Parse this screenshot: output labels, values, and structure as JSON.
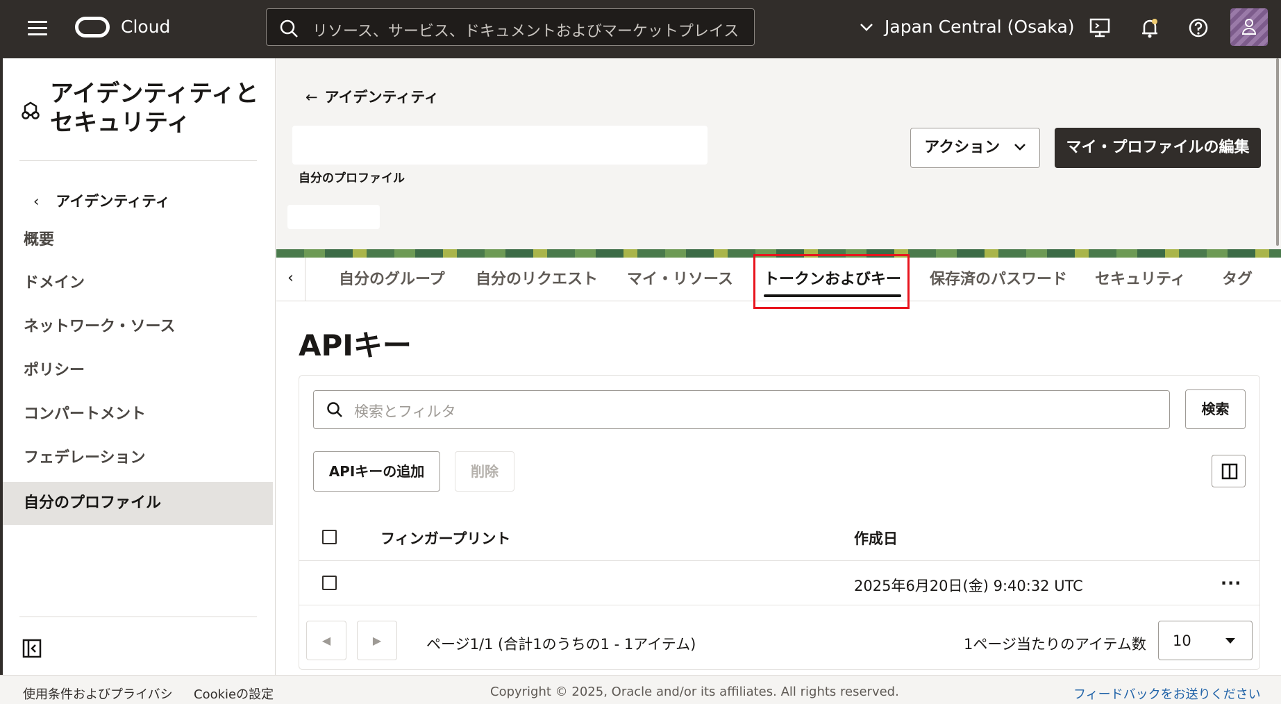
{
  "topbar": {
    "logo_text": "Cloud",
    "search_placeholder": "リソース、サービス、ドキュメントおよびマーケットプレイス",
    "region": "Japan Central (Osaka)"
  },
  "sidebar": {
    "title_line1": "アイデンティティと",
    "title_line2": "セキュリティ",
    "back_label": "アイデンティティ",
    "items": [
      {
        "label": "概要"
      },
      {
        "label": "ドメイン"
      },
      {
        "label": "ネットワーク・ソース"
      },
      {
        "label": "ポリシー"
      },
      {
        "label": "コンパートメント"
      },
      {
        "label": "フェデレーション"
      },
      {
        "label": "自分のプロファイル"
      }
    ]
  },
  "header": {
    "breadcrumb": "アイデンティティ",
    "subtitle": "自分のプロファイル",
    "actions_label": "アクション",
    "edit_label": "マイ・プロファイルの編集"
  },
  "tabs": [
    {
      "label": "自分のグループ"
    },
    {
      "label": "自分のリクエスト"
    },
    {
      "label": "マイ・リソース"
    },
    {
      "label": "トークンおよびキー"
    },
    {
      "label": "保存済のパスワード"
    },
    {
      "label": "セキュリティ"
    },
    {
      "label": "タグ"
    }
  ],
  "api_keys": {
    "title": "APIキー",
    "filter_placeholder": "検索とフィルタ",
    "search_label": "検索",
    "add_label": "APIキーの追加",
    "delete_label": "削除",
    "columns": {
      "fingerprint": "フィンガープリント",
      "created": "作成日"
    },
    "rows": [
      {
        "fingerprint": "",
        "created": "2025年6月20日(金) 9:40:32 UTC"
      }
    ],
    "pagination_text": "ページ1/1 (合計1のうちの1 - 1アイテム)",
    "per_page_label": "1ページ当たりのアイテム数",
    "per_page_value": "10"
  },
  "footer": {
    "terms": "使用条件およびプライバシ",
    "cookie": "Cookieの設定",
    "copyright": "Copyright © 2025, Oracle and/or its affiliates. All rights reserved.",
    "feedback": "フィードバックをお送りください"
  },
  "colors": {
    "topbar": "#312d2a",
    "highlight": "#e8141d",
    "link": "#2163a8"
  }
}
